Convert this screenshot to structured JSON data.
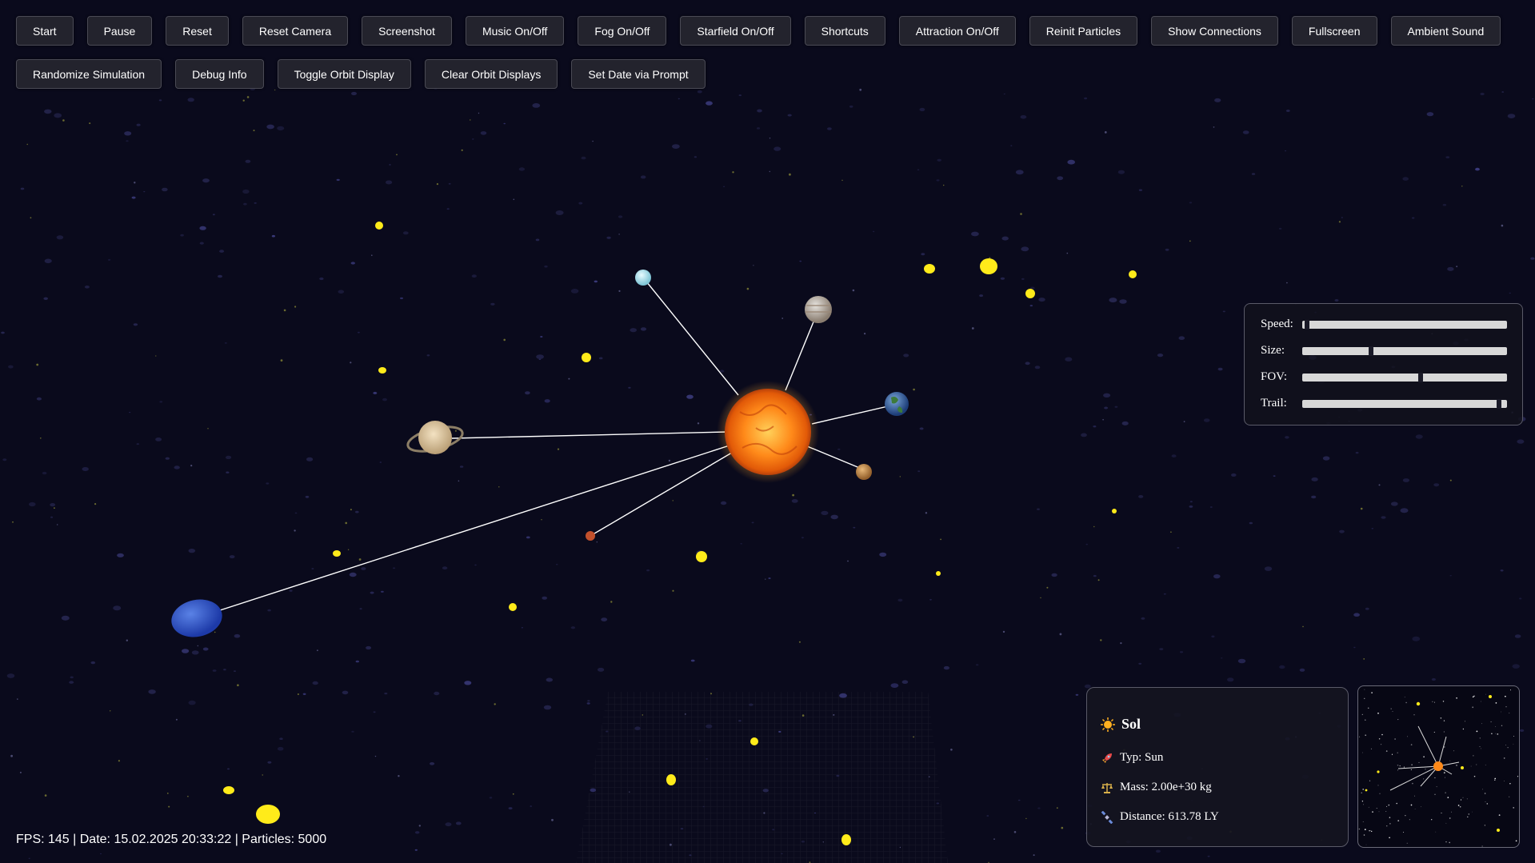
{
  "toolbar": {
    "row1": [
      "Start",
      "Pause",
      "Reset",
      "Reset Camera",
      "Screenshot",
      "Music On/Off",
      "Fog On/Off",
      "Starfield On/Off",
      "Shortcuts",
      "Attraction On/Off",
      "Reinit Particles",
      "Show Connections",
      "Fullscreen",
      "Ambient Sound"
    ],
    "row2": [
      "Randomize Simulation",
      "Debug Info",
      "Toggle Orbit Display",
      "Clear Orbit Displays",
      "Set Date via Prompt"
    ]
  },
  "controls": {
    "speed_label": "Speed:",
    "speed_value": 0.01,
    "size_label": "Size:",
    "size_value": 0.33,
    "fov_label": "FOV:",
    "fov_value": 0.58,
    "trail_label": "Trail:",
    "trail_value": 0.97
  },
  "info": {
    "name": "Sol",
    "type": "Typ: Sun",
    "mass": "Mass: 2.00e+30 kg",
    "distance": "Distance: 613.78 LY",
    "sun_icon": "sun-icon",
    "type_icon": "rocket-icon",
    "mass_icon": "scale-icon",
    "distance_icon": "satellite-icon"
  },
  "status": {
    "text": "FPS: 145 | Date: 15.02.2025 20:33:22 | Particles: 5000"
  },
  "colors": {
    "background": "#0a0a1c",
    "sun": "#ff8a1a",
    "particle": "#ffeb1a",
    "connection": "#ffffff"
  }
}
